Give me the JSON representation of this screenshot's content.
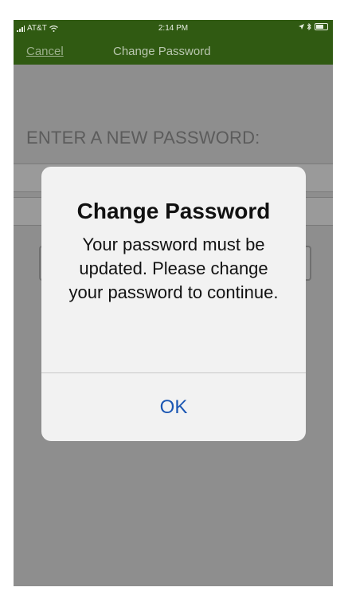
{
  "status_bar": {
    "carrier": "AT&T",
    "time": "2:14 PM"
  },
  "nav": {
    "cancel_label": "Cancel",
    "title": "Change Password"
  },
  "form": {
    "heading": "ENTER A NEW PASSWORD:"
  },
  "dialog": {
    "title": "Change Password",
    "message": "Your password must be updated. Please change your password to continue.",
    "ok_label": "OK"
  },
  "colors": {
    "nav_background": "#305a12",
    "dialog_button": "#1a56b3",
    "overlay": "#8e8e8e"
  }
}
